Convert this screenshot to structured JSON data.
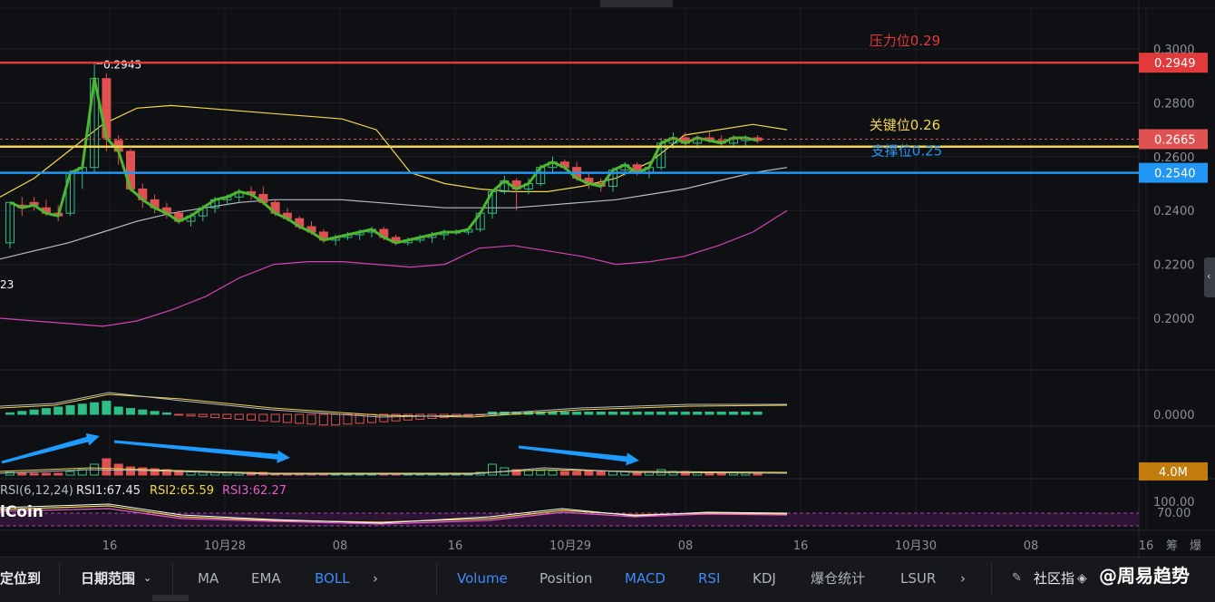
{
  "chart_data": {
    "type": "candlestick",
    "y_range": [
      0.18,
      0.305
    ],
    "y_ticks": [
      "0.3000",
      "0.2800",
      "0.2600",
      "0.2400",
      "0.2200",
      "0.2000"
    ],
    "x_ticks": [
      "16",
      "10月28",
      "08",
      "16",
      "10月29",
      "08",
      "16",
      "10月30",
      "08",
      "16"
    ],
    "x_suffix_labels": [
      "筹",
      "爆"
    ],
    "high_label": "0.2945",
    "left_edge_label": "23",
    "candles": [
      [
        0.228,
        0.243,
        0.226,
        0.243
      ],
      [
        0.242,
        0.245,
        0.238,
        0.241
      ],
      [
        0.243,
        0.245,
        0.24,
        0.242
      ],
      [
        0.241,
        0.244,
        0.238,
        0.239
      ],
      [
        0.239,
        0.242,
        0.236,
        0.238
      ],
      [
        0.239,
        0.255,
        0.238,
        0.254
      ],
      [
        0.254,
        0.258,
        0.248,
        0.256
      ],
      [
        0.256,
        0.295,
        0.254,
        0.289
      ],
      [
        0.289,
        0.291,
        0.262,
        0.267
      ],
      [
        0.266,
        0.268,
        0.257,
        0.262
      ],
      [
        0.262,
        0.263,
        0.247,
        0.248
      ],
      [
        0.248,
        0.25,
        0.241,
        0.244
      ],
      [
        0.244,
        0.246,
        0.239,
        0.241
      ],
      [
        0.241,
        0.243,
        0.237,
        0.239
      ],
      [
        0.239,
        0.24,
        0.235,
        0.236
      ],
      [
        0.236,
        0.239,
        0.234,
        0.238
      ],
      [
        0.238,
        0.242,
        0.236,
        0.241
      ],
      [
        0.241,
        0.245,
        0.239,
        0.244
      ],
      [
        0.244,
        0.246,
        0.242,
        0.245
      ],
      [
        0.245,
        0.248,
        0.243,
        0.247
      ],
      [
        0.247,
        0.249,
        0.244,
        0.246
      ],
      [
        0.246,
        0.249,
        0.242,
        0.243
      ],
      [
        0.243,
        0.244,
        0.238,
        0.239
      ],
      [
        0.239,
        0.241,
        0.236,
        0.237
      ],
      [
        0.237,
        0.238,
        0.233,
        0.234
      ],
      [
        0.234,
        0.236,
        0.231,
        0.232
      ],
      [
        0.232,
        0.233,
        0.228,
        0.229
      ],
      [
        0.229,
        0.231,
        0.227,
        0.23
      ],
      [
        0.23,
        0.232,
        0.229,
        0.231
      ],
      [
        0.231,
        0.233,
        0.229,
        0.232
      ],
      [
        0.232,
        0.234,
        0.23,
        0.233
      ],
      [
        0.233,
        0.234,
        0.229,
        0.23
      ],
      [
        0.23,
        0.231,
        0.227,
        0.228
      ],
      [
        0.228,
        0.23,
        0.227,
        0.229
      ],
      [
        0.229,
        0.231,
        0.228,
        0.23
      ],
      [
        0.23,
        0.232,
        0.228,
        0.231
      ],
      [
        0.231,
        0.233,
        0.229,
        0.232
      ],
      [
        0.232,
        0.233,
        0.231,
        0.232
      ],
      [
        0.232,
        0.233,
        0.231,
        0.233
      ],
      [
        0.233,
        0.24,
        0.232,
        0.239
      ],
      [
        0.239,
        0.248,
        0.237,
        0.247
      ],
      [
        0.247,
        0.253,
        0.246,
        0.251
      ],
      [
        0.251,
        0.252,
        0.24,
        0.248
      ],
      [
        0.248,
        0.252,
        0.246,
        0.25
      ],
      [
        0.25,
        0.257,
        0.249,
        0.256
      ],
      [
        0.256,
        0.26,
        0.254,
        0.258
      ],
      [
        0.258,
        0.259,
        0.255,
        0.256
      ],
      [
        0.256,
        0.258,
        0.251,
        0.252
      ],
      [
        0.252,
        0.254,
        0.248,
        0.25
      ],
      [
        0.25,
        0.252,
        0.247,
        0.249
      ],
      [
        0.249,
        0.256,
        0.247,
        0.255
      ],
      [
        0.255,
        0.258,
        0.253,
        0.257
      ],
      [
        0.257,
        0.258,
        0.253,
        0.254
      ],
      [
        0.254,
        0.258,
        0.252,
        0.256
      ],
      [
        0.256,
        0.267,
        0.255,
        0.265
      ],
      [
        0.265,
        0.269,
        0.263,
        0.267
      ],
      [
        0.267,
        0.269,
        0.264,
        0.265
      ],
      [
        0.265,
        0.268,
        0.263,
        0.267
      ],
      [
        0.267,
        0.269,
        0.265,
        0.266
      ],
      [
        0.266,
        0.268,
        0.264,
        0.265
      ],
      [
        0.265,
        0.268,
        0.264,
        0.267
      ],
      [
        0.266,
        0.268,
        0.264,
        0.267
      ],
      [
        0.267,
        0.268,
        0.265,
        0.266
      ]
    ],
    "levels": [
      {
        "label": "压力位0.29",
        "value": 0.2949,
        "tag": "0.2949",
        "color": "#e03a3a"
      },
      {
        "label": "关键位0.26",
        "value": 0.2637,
        "tag": "0.2665",
        "tag_value": 0.2665,
        "color": "#f2d64b"
      },
      {
        "label": "支撑位0.25",
        "value": 0.254,
        "tag": "0.2540",
        "color": "#2196f3"
      }
    ],
    "boll_upper": [
      0.245,
      0.252,
      0.262,
      0.272,
      0.278,
      0.279,
      0.278,
      0.277,
      0.276,
      0.275,
      0.274,
      0.27,
      0.254,
      0.25,
      0.248,
      0.247,
      0.247,
      0.249,
      0.252,
      0.258,
      0.268,
      0.27,
      0.272,
      0.27
    ],
    "boll_mid": [
      0.222,
      0.225,
      0.228,
      0.232,
      0.236,
      0.239,
      0.241,
      0.243,
      0.244,
      0.244,
      0.244,
      0.243,
      0.242,
      0.241,
      0.241,
      0.241,
      0.242,
      0.243,
      0.244,
      0.246,
      0.248,
      0.251,
      0.254,
      0.256
    ],
    "boll_lower": [
      0.2,
      0.199,
      0.198,
      0.197,
      0.199,
      0.203,
      0.208,
      0.215,
      0.22,
      0.221,
      0.221,
      0.22,
      0.219,
      0.22,
      0.226,
      0.227,
      0.225,
      0.223,
      0.22,
      0.221,
      0.223,
      0.227,
      0.232,
      0.24
    ],
    "indicator_tick": "0.0000",
    "volume_tag": "4.0M",
    "rsi_label": "RSI(6,12,24)",
    "rsi_values": [
      "RSI1:67.45",
      "RSI2:65.59",
      "RSI3:62.27"
    ],
    "rsi_ticks": [
      "100.00",
      "70.00"
    ],
    "colors": {
      "up": "#2ebd85",
      "down": "#e05151",
      "trend": "#4db82f",
      "mid": "#b9bdc4",
      "lower": "#d63fb5",
      "upper": "#f2d64b",
      "arrow": "#1e9bff"
    }
  },
  "watermark": "iCoin",
  "toolbar": {
    "left_cut": "定位到",
    "date_range": "日期范围",
    "indicators_main": [
      "MA",
      "EMA",
      "BOLL"
    ],
    "indicators_sub": [
      "Volume",
      "Position",
      "MACD",
      "RSI",
      "KDJ",
      "爆仓统计",
      "LSUR"
    ],
    "community": "社区指",
    "author": "@周易趋势"
  }
}
